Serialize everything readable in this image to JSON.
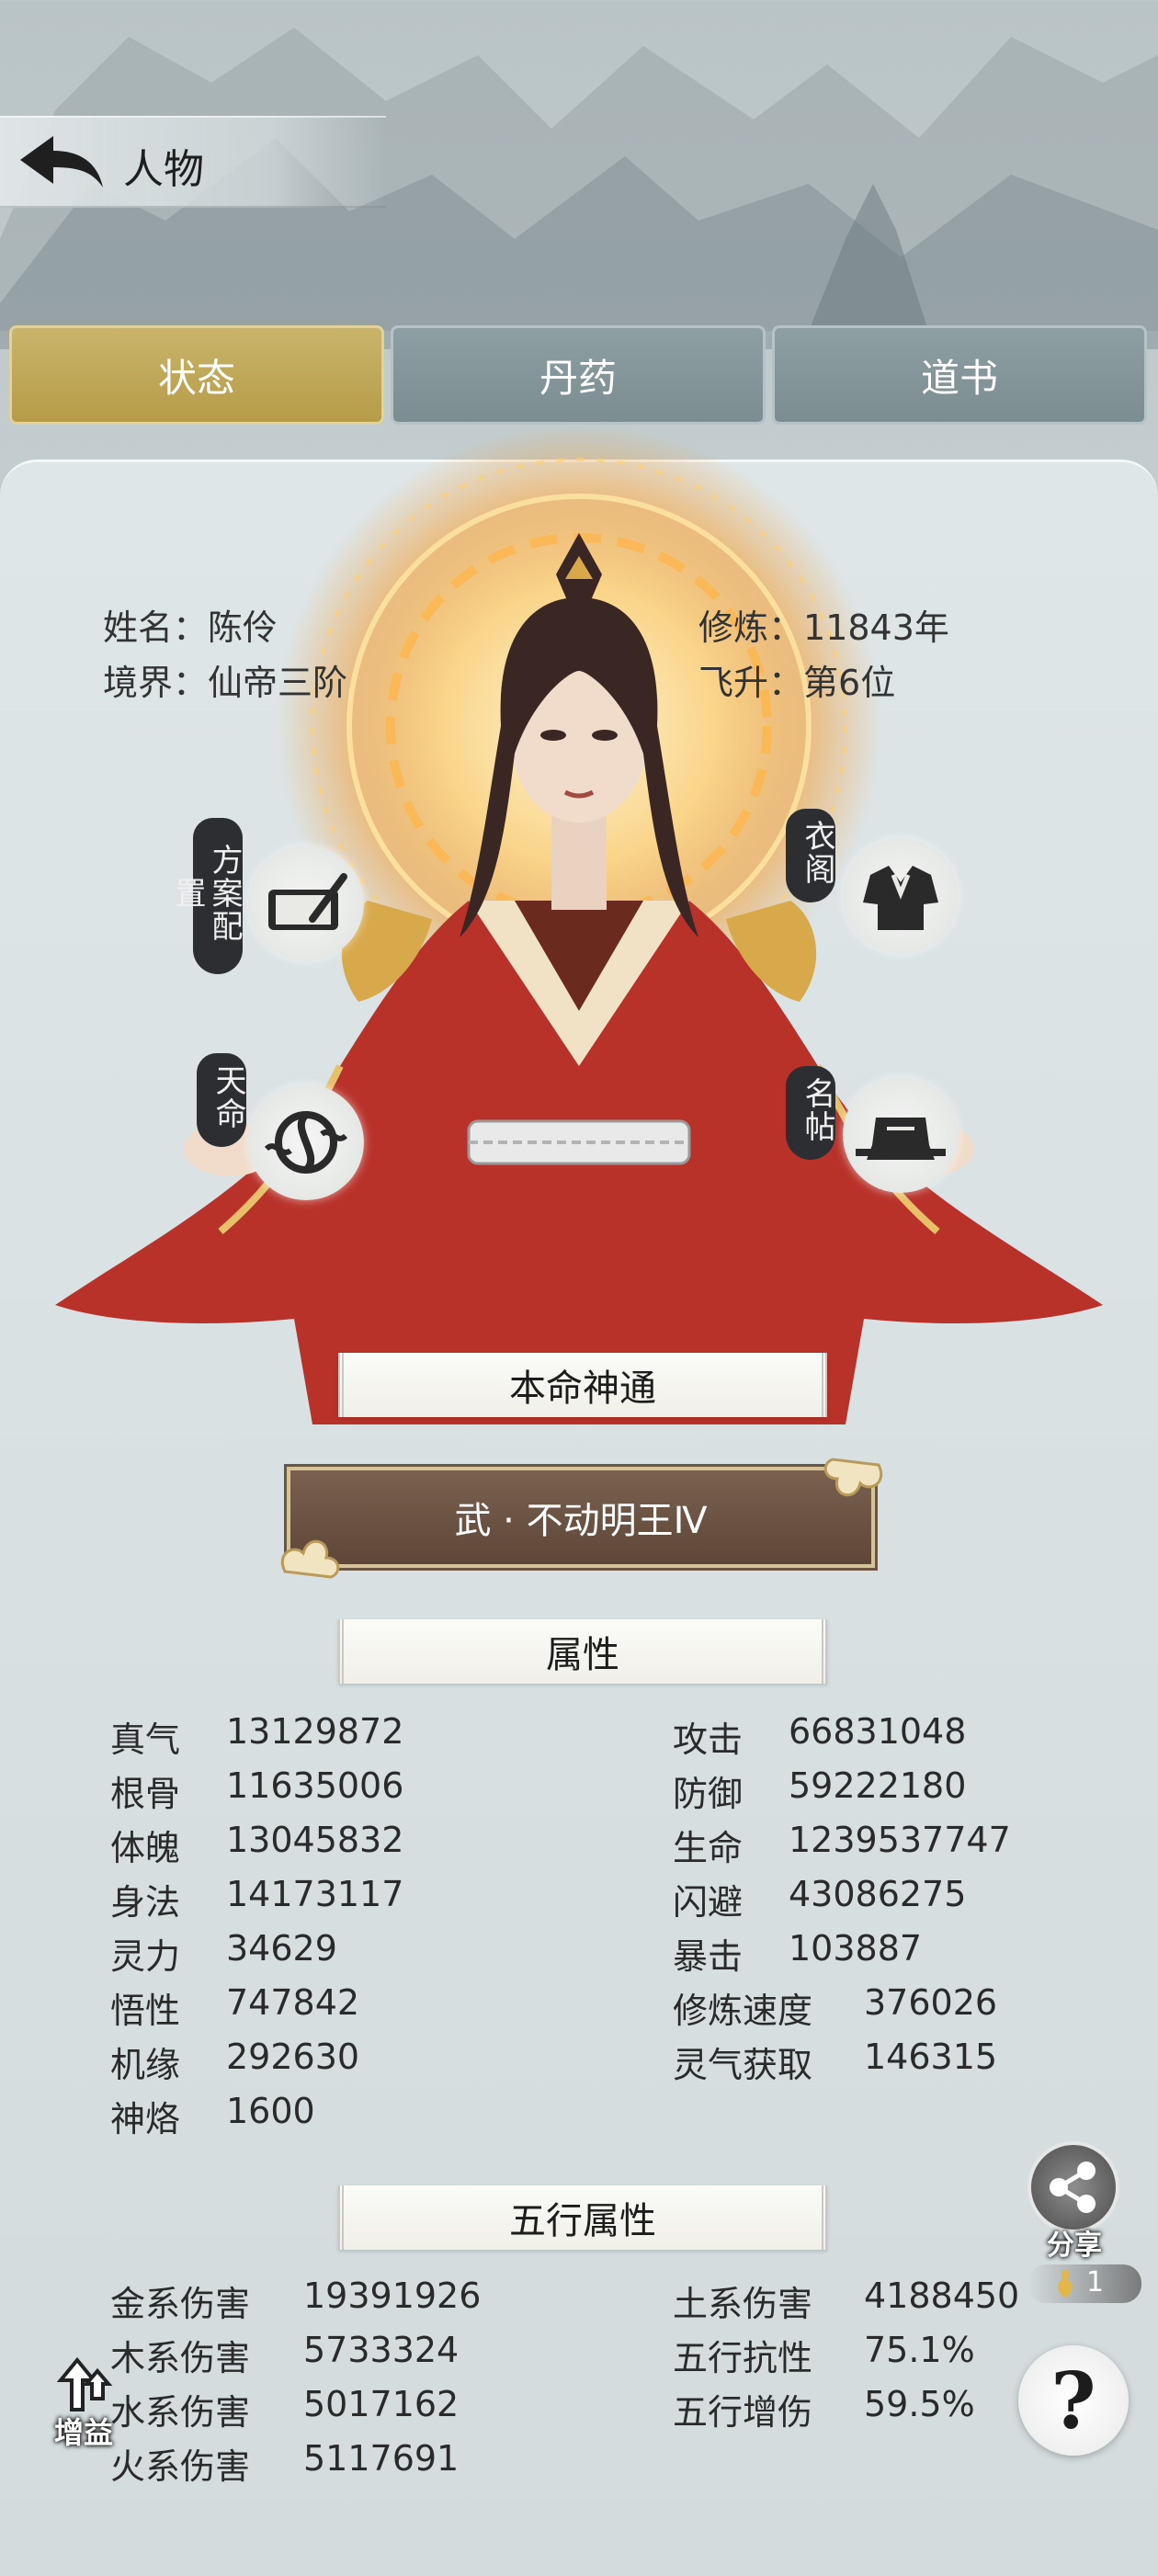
{
  "header": {
    "title": "人物"
  },
  "tabs": [
    {
      "label": "状态",
      "active": true
    },
    {
      "label": "丹药",
      "active": false
    },
    {
      "label": "道书",
      "active": false
    }
  ],
  "profile": {
    "name_label": "姓名：",
    "name": "陈伶",
    "realm_label": "境界：",
    "realm": "仙帝三阶",
    "cultivate_label": "修炼：",
    "cultivate": "11843年",
    "ascend_label": "飞升：",
    "ascend": "第6位"
  },
  "side_buttons": {
    "plan": "方案配置",
    "wardrobe": "衣阁",
    "fate": "天命",
    "card": "名帖"
  },
  "skill": {
    "section_title": "本命神通",
    "name": "武 · 不动明王Ⅳ"
  },
  "attributes": {
    "section_title": "属性",
    "left": [
      {
        "label": "真气",
        "value": "13129872"
      },
      {
        "label": "根骨",
        "value": "11635006"
      },
      {
        "label": "体魄",
        "value": "13045832"
      },
      {
        "label": "身法",
        "value": "14173117"
      },
      {
        "label": "灵力",
        "value": "34629"
      },
      {
        "label": "悟性",
        "value": "747842"
      },
      {
        "label": "机缘",
        "value": "292630"
      },
      {
        "label": "神烙",
        "value": "1600"
      }
    ],
    "right": [
      {
        "label": "攻击",
        "value": "66831048"
      },
      {
        "label": "防御",
        "value": "59222180"
      },
      {
        "label": "生命",
        "value": "1239537747"
      },
      {
        "label": "闪避",
        "value": "43086275"
      },
      {
        "label": "暴击",
        "value": "103887"
      },
      {
        "label": "修炼速度",
        "value": "376026"
      },
      {
        "label": "灵气获取",
        "value": "146315"
      }
    ]
  },
  "elements": {
    "section_title": "五行属性",
    "left": [
      {
        "label": "金系伤害",
        "value": "19391926"
      },
      {
        "label": "木系伤害",
        "value": "5733324"
      },
      {
        "label": "水系伤害",
        "value": "5017162"
      },
      {
        "label": "火系伤害",
        "value": "5117691"
      }
    ],
    "right": [
      {
        "label": "土系伤害",
        "value": "4188450"
      },
      {
        "label": "五行抗性",
        "value": "75.1%"
      },
      {
        "label": "五行增伤",
        "value": "59.5%"
      }
    ]
  },
  "floating": {
    "share_label": "分享",
    "share_count": "1",
    "boost_label": "增益",
    "help_glyph": "?"
  },
  "colors": {
    "tab_active": "#b59c48",
    "tab_normal": "#7b8d91",
    "skill_bg": "#5e4738",
    "robe": "#b8322a",
    "fire": "#f39a2a"
  }
}
